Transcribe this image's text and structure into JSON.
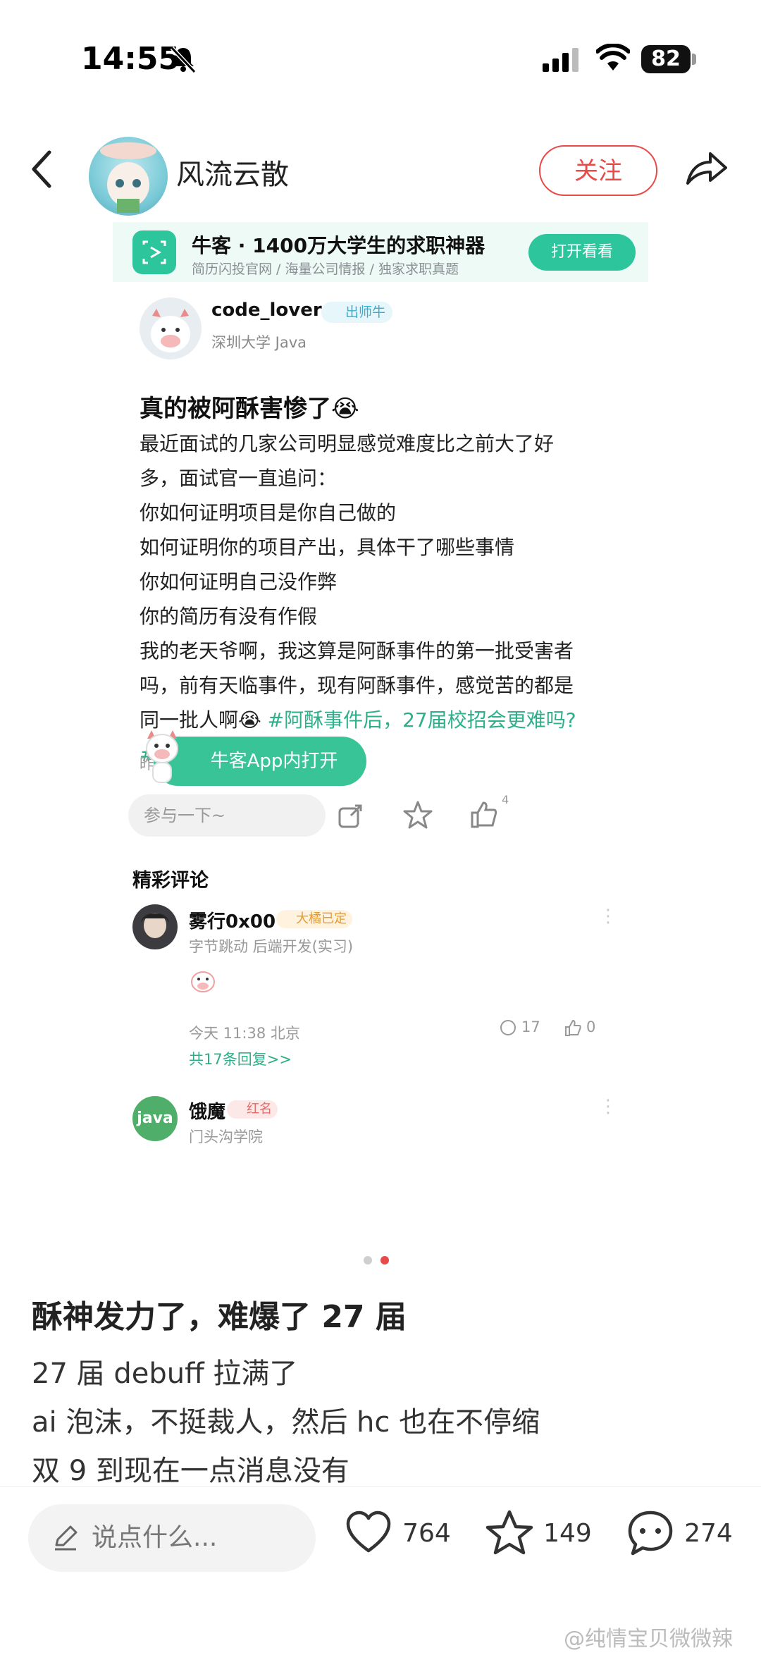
{
  "status_bar": {
    "time": "14:55",
    "battery": "82"
  },
  "header": {
    "author": "风流云散",
    "follow_label": "关注"
  },
  "embedded": {
    "banner": {
      "title": "牛客 · 1400万大学生的求职神器",
      "subtitle": "简历闪投官网 / 海量公司情报 / 独家求职真题",
      "button": "打开看看"
    },
    "post": {
      "username": "code_lover",
      "badge": "出师牛",
      "subtitle": "深圳大学 Java",
      "title": "真的被阿酥害惨了😭",
      "body": [
        "最近面试的几家公司明显感觉难度比之前大了好",
        "多，面试官一直追问：",
        "你如何证明项目是你自己做的",
        "如何证明你的项目产出，具体干了哪些事情",
        "你如何证明自己没作弊",
        "你的简历有没有作假",
        "我的老天爷啊，我这算是阿酥事件的第一批受害者",
        "吗，前有天临事件，现有阿酥事件，感觉苦的都是"
      ],
      "last_line": "同一批人啊😭 ",
      "hashtag": "#阿酥事件后，27届校招会更难吗?",
      "hashtag_end": "#",
      "time": "昨天 16:40"
    },
    "comments": {
      "header": "精彩评论",
      "items": [
        {
          "name": "雾行0x00",
          "badge": "大橘已定",
          "sub": "字节跳动 后端开发(实习)",
          "meta": "今天 11:38 北京",
          "replies_count": "17",
          "likes": "0",
          "more_replies": "共17条回复>>"
        },
        {
          "name": "饿魔",
          "avatar_text": "java",
          "badge": "红名",
          "sub": "门头沟学院"
        }
      ]
    },
    "open_app": "牛客App内打开",
    "comment_input_placeholder": "参与一下~",
    "like_count": "4"
  },
  "main": {
    "title": "酥神发力了，难爆了 27 届",
    "body": [
      "27 届 debuff 拉满了",
      "ai 泡沫，不挺裁人，然后 hc 也在不停缩",
      "双 9 到现在一点消息没有"
    ]
  },
  "bottom_bar": {
    "placeholder": "说点什么...",
    "likes": "764",
    "stars": "149",
    "comments": "274"
  },
  "watermark": "@纯情宝贝微微辣",
  "colors": {
    "accent_red": "#e84a4a",
    "niuke_green": "#2cc59c"
  }
}
